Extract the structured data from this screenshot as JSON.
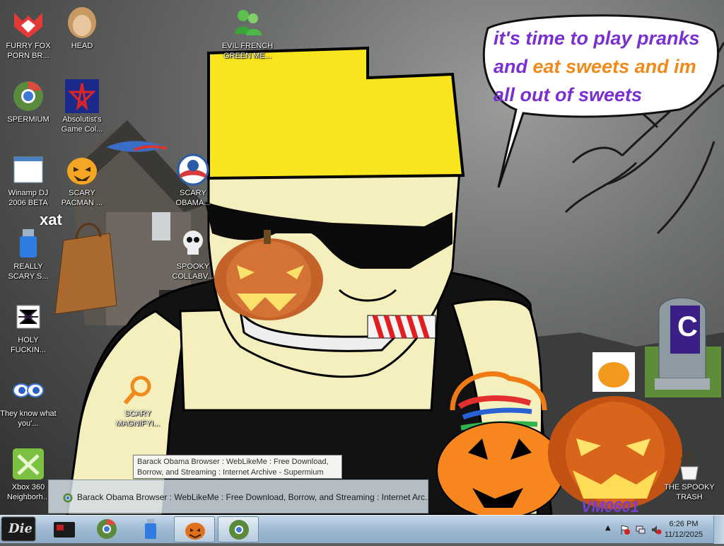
{
  "desktop_icons": [
    {
      "id": "furry-fox",
      "label": "FURRY FOX PORN BR..."
    },
    {
      "id": "head",
      "label": "HEAD"
    },
    {
      "id": "evil-french",
      "label": "EVIL FRENCH GREEN ME..."
    },
    {
      "id": "spermium",
      "label": "SPERMIUM"
    },
    {
      "id": "absolutist",
      "label": "Absolutist's Game Col..."
    },
    {
      "id": "winamp",
      "label": "Winamp DJ 2006 BETA"
    },
    {
      "id": "scary-pacman",
      "label": "SCARY PACMAN ..."
    },
    {
      "id": "scary-obama",
      "label": "SCARY OBAMA..."
    },
    {
      "id": "really-scary",
      "label": "REALLY SCARY S..."
    },
    {
      "id": "spooky-collab",
      "label": "SPOOKY COLLABV..."
    },
    {
      "id": "holy",
      "label": "HOLY FUCKIN..."
    },
    {
      "id": "they-know",
      "label": "They know what you'..."
    },
    {
      "id": "scary-magnifier",
      "label": "SCARY MAGNIFYI..."
    },
    {
      "id": "xbox",
      "label": "Xbox 360 Neighborh..."
    },
    {
      "id": "spooky-trash",
      "label": "THE SPOOKY TRASH"
    }
  ],
  "wallpaper": {
    "bubble_line1": "it's time to play pranks",
    "bubble_line2a": "and ",
    "bubble_line2b": "eat sweets and im",
    "bubble_line3": "all out of sweets",
    "xat_logo": "xat",
    "signature": "VM0601",
    "tombstone_letter": "C"
  },
  "tooltip": {
    "text": "Barack Obama Browser : WebLikeMe : Free Download, Borrow, and Streaming : Internet Archive - Supermium"
  },
  "preview": {
    "title": "Barack Obama Browser : WebLikeMe : Free Download, Borrow, and Streaming : Internet Arc..."
  },
  "taskbar": {
    "start_label": "Die",
    "clock_time": "6:26 PM",
    "clock_date": "11/12/2025"
  },
  "colors": {
    "bubble_purple": "#7a2fd0",
    "bubble_orange": "#f08a1a",
    "taskbar": "#a9c1d7"
  }
}
